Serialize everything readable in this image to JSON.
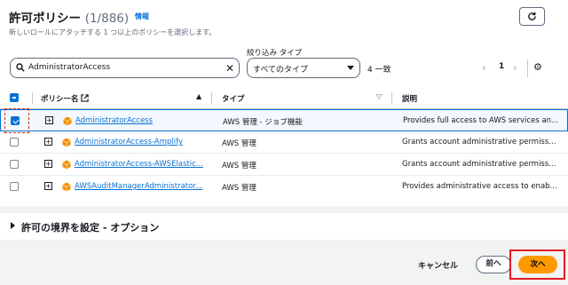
{
  "header": {
    "title": "許可ポリシー",
    "count": "(1/886)",
    "info": "情報",
    "subtitle": "新しいロールにアタッチする 1 つ以上のポリシーを選択します。"
  },
  "filter": {
    "search_value": "AdministratorAccess",
    "type_label": "絞り込み タイプ",
    "type_value": "すべてのタイプ",
    "match_count": "4 一致",
    "page": "1"
  },
  "table": {
    "columns": [
      "ポリシー名",
      "タイプ",
      "説明"
    ],
    "rows": [
      {
        "name": "AdministratorAccess",
        "type": "AWS 管理 - ジョブ機能",
        "description": "Provides full access to AWS services an...",
        "checked": true
      },
      {
        "name": "AdministratorAccess-Amplify",
        "type": "AWS 管理",
        "description": "Grants account administrative permiss...",
        "checked": false
      },
      {
        "name": "AdministratorAccess-AWSElastic...",
        "type": "AWS 管理",
        "description": "Grants account administrative permiss...",
        "checked": false
      },
      {
        "name": "AWSAuditManagerAdministrator...",
        "type": "AWS 管理",
        "description": "Provides administrative access to enab...",
        "checked": false
      }
    ]
  },
  "section": {
    "title": "許可の境界を設定 - オプション"
  },
  "footer": {
    "cancel": "キャンセル",
    "prev": "前へ",
    "next": "次へ"
  },
  "colors": {
    "primary_button": "#ff9900",
    "link": "#0972d3",
    "annotation": "#e01b24"
  }
}
